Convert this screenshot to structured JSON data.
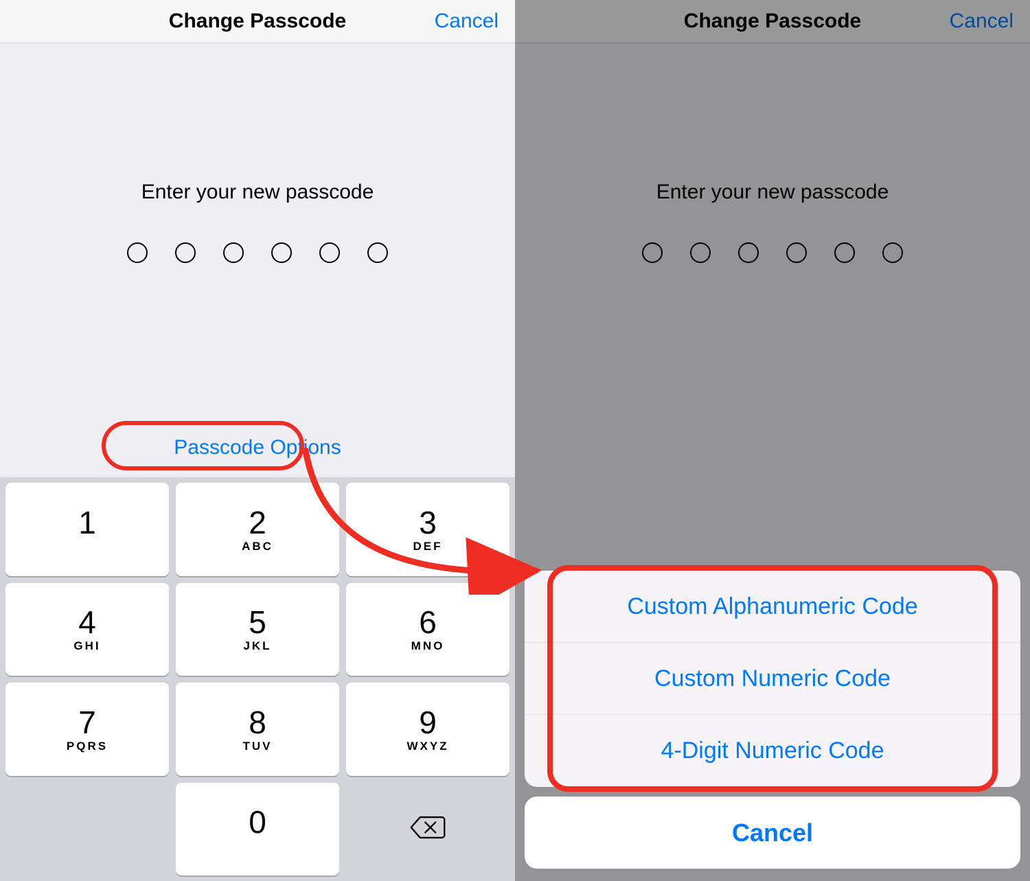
{
  "left": {
    "nav_title": "Change Passcode",
    "nav_cancel": "Cancel",
    "prompt": "Enter your new passcode",
    "passcode_options": "Passcode Options",
    "keypad": [
      {
        "digit": "1",
        "letters": ""
      },
      {
        "digit": "2",
        "letters": "ABC"
      },
      {
        "digit": "3",
        "letters": "DEF"
      },
      {
        "digit": "4",
        "letters": "GHI"
      },
      {
        "digit": "5",
        "letters": "JKL"
      },
      {
        "digit": "6",
        "letters": "MNO"
      },
      {
        "digit": "7",
        "letters": "PQRS"
      },
      {
        "digit": "8",
        "letters": "TUV"
      },
      {
        "digit": "9",
        "letters": "WXYZ"
      },
      {
        "digit": "0",
        "letters": ""
      }
    ]
  },
  "right": {
    "nav_title": "Change Passcode",
    "nav_cancel": "Cancel",
    "prompt": "Enter your new passcode",
    "options": [
      "Custom Alphanumeric Code",
      "Custom Numeric Code",
      "4-Digit Numeric Code"
    ],
    "sheet_cancel": "Cancel"
  }
}
